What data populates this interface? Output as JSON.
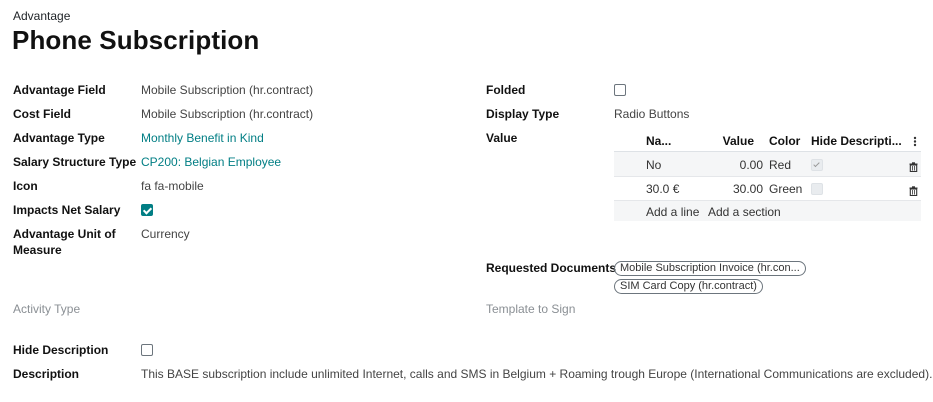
{
  "breadcrumb": "Advantage",
  "title": "Phone Subscription",
  "left_fields": [
    {
      "label": "Advantage Field",
      "value": "Mobile Subscription (hr.contract)"
    },
    {
      "label": "Cost Field",
      "value": "Mobile Subscription (hr.contract)"
    },
    {
      "label": "Advantage Type",
      "value": "Monthly Benefit in Kind"
    },
    {
      "label": "Salary Structure Type",
      "value": "CP200: Belgian Employee"
    },
    {
      "label": "Icon",
      "value": "fa fa-mobile"
    },
    {
      "label": "Impacts Net Salary",
      "checked": true
    },
    {
      "label_line1": "Advantage Unit of",
      "label_line2": "Measure",
      "value": "Currency"
    },
    {
      "label": "Activity Type",
      "value": ""
    },
    {
      "label": "Hide Description",
      "checked": false
    },
    {
      "label": "Description",
      "value": "This BASE subscription include unlimited Internet, calls and SMS in Belgium + Roaming trough Europe (International Communications are excluded)."
    }
  ],
  "right_fields": {
    "folded": {
      "label": "Folded",
      "checked": false
    },
    "display_type": {
      "label": "Display Type",
      "value": "Radio Buttons"
    },
    "value_label": "Value",
    "requested_documents": {
      "label": "Requested Documents",
      "tags": [
        "Mobile Subscription Invoice (hr.con...",
        "SIM Card Copy (hr.contract)"
      ]
    },
    "template_to_sign": {
      "label": "Template to Sign",
      "value": ""
    }
  },
  "value_table": {
    "headers": {
      "name": "Na...",
      "value": "Value",
      "color": "Color",
      "hide": "Hide Descripti..."
    },
    "rows": [
      {
        "name": "No",
        "value": "0.00",
        "color": "Red",
        "hide_description": true
      },
      {
        "name": "30.0 €",
        "value": "30.00",
        "color": "Green",
        "hide_description": false
      }
    ],
    "add_line": "Add a line",
    "add_section": "Add a section"
  },
  "icons": {
    "column_options": "vertical-ellipsis-icon",
    "row_delete": "trash-icon"
  },
  "colors": {
    "accent": "#017e84",
    "muted_label": "#8a8f94"
  }
}
